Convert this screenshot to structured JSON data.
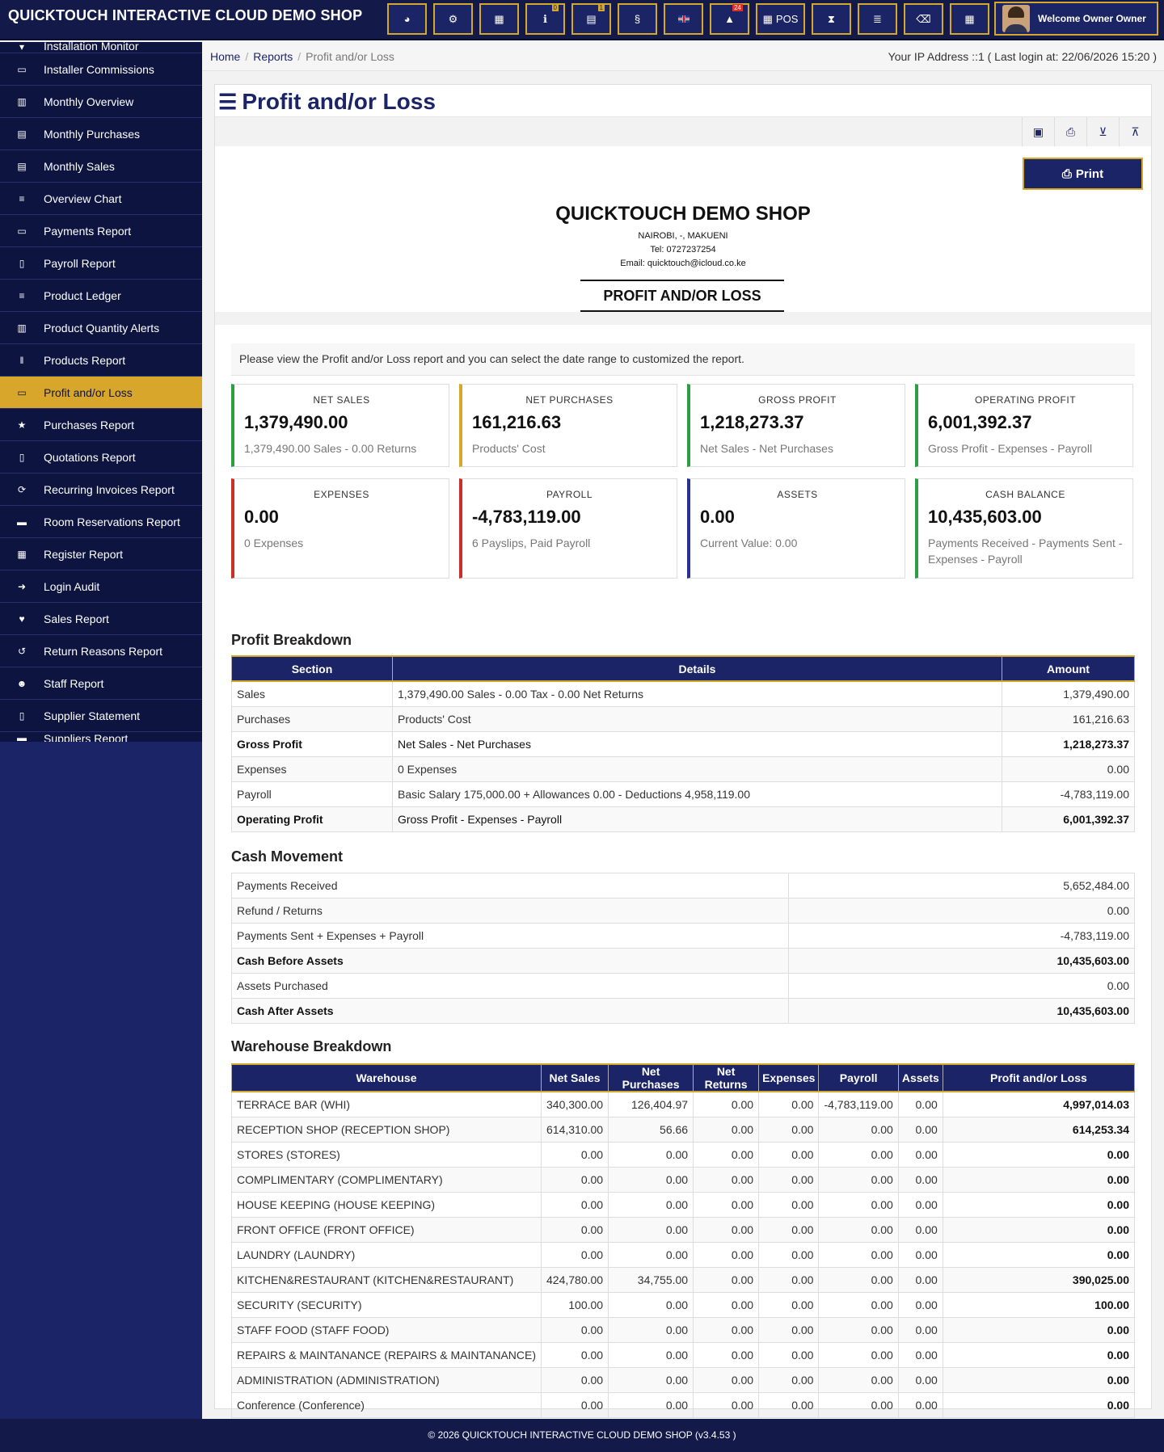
{
  "app": {
    "title": "QUICKTOUCH INTERACTIVE CLOUD DEMO SHOP",
    "welcome": "Welcome Owner Owner",
    "pos_label": "POS"
  },
  "topbar": {
    "badge_info": "0",
    "badge_calendar": "1",
    "badge_alert": "24"
  },
  "sidebar": {
    "partial_top": "Installation Monitor",
    "items": [
      {
        "label": "Installer Commissions",
        "icon": "money-icon"
      },
      {
        "label": "Monthly Overview",
        "icon": "bar-chart-icon"
      },
      {
        "label": "Monthly Purchases",
        "icon": "calendar-icon"
      },
      {
        "label": "Monthly Sales",
        "icon": "calendar-icon"
      },
      {
        "label": "Overview Chart",
        "icon": "list-icon"
      },
      {
        "label": "Payments Report",
        "icon": "money-icon"
      },
      {
        "label": "Payroll Report",
        "icon": "file-icon"
      },
      {
        "label": "Product Ledger",
        "icon": "list-icon"
      },
      {
        "label": "Product Quantity Alerts",
        "icon": "bar-chart-icon"
      },
      {
        "label": "Products Report",
        "icon": "barcode-icon"
      },
      {
        "label": "Profit and/or Loss",
        "icon": "money-icon"
      },
      {
        "label": "Purchases Report",
        "icon": "star-icon"
      },
      {
        "label": "Quotations Report",
        "icon": "file-icon"
      },
      {
        "label": "Recurring Invoices Report",
        "icon": "refresh-icon"
      },
      {
        "label": "Room Reservations Report",
        "icon": "bed-icon"
      },
      {
        "label": "Register Report",
        "icon": "grid-icon"
      },
      {
        "label": "Login Audit",
        "icon": "sign-in-icon"
      },
      {
        "label": "Sales Report",
        "icon": "heart-icon"
      },
      {
        "label": "Return Reasons Report",
        "icon": "undo-icon"
      },
      {
        "label": "Staff Report",
        "icon": "users-icon"
      },
      {
        "label": "Supplier Statement",
        "icon": "file-icon"
      }
    ],
    "partial_bottom": "Suppliers Report"
  },
  "breadcrumb": {
    "home": "Home",
    "reports": "Reports",
    "current": "Profit and/or Loss"
  },
  "ip_info": "Your IP Address ::1 ( Last login at: 22/06/2026 15:20 )",
  "page_title": "Profit and/or Loss",
  "print_label": "Print",
  "shop": {
    "name": "QUICKTOUCH DEMO SHOP",
    "address": "NAIROBI, -, MAKUENI",
    "tel": "Tel: 0727237254",
    "email": "Email: quicktouch@icloud.co.ke",
    "report_title": "PROFIT AND/OR LOSS"
  },
  "intro": "Please view the Profit and/or Loss report and you can select the date range to customized the report.",
  "cards": [
    {
      "title": "NET SALES",
      "value": "1,379,490.00",
      "sub": "1,379,490.00 Sales - 0.00 Returns"
    },
    {
      "title": "NET PURCHASES",
      "value": "161,216.63",
      "sub": "Products' Cost"
    },
    {
      "title": "GROSS PROFIT",
      "value": "1,218,273.37",
      "sub": "Net Sales - Net Purchases"
    },
    {
      "title": "OPERATING PROFIT",
      "value": "6,001,392.37",
      "sub": "Gross Profit - Expenses - Payroll"
    },
    {
      "title": "EXPENSES",
      "value": "0.00",
      "sub": "0 Expenses"
    },
    {
      "title": "PAYROLL",
      "value": "-4,783,119.00",
      "sub": "6 Payslips, Paid Payroll"
    },
    {
      "title": "ASSETS",
      "value": "0.00",
      "sub": "Current Value: 0.00"
    },
    {
      "title": "CASH BALANCE",
      "value": "10,435,603.00",
      "sub": "Payments Received - Payments Sent - Expenses - Payroll"
    }
  ],
  "profit_breakdown": {
    "title": "Profit Breakdown",
    "headers": [
      "Section",
      "Details",
      "Amount"
    ],
    "rows": [
      [
        "Sales",
        "1,379,490.00 Sales - 0.00 Tax - 0.00 Net Returns",
        "1,379,490.00"
      ],
      [
        "Purchases",
        "Products' Cost",
        "161,216.63"
      ],
      [
        "Gross Profit",
        "Net Sales - Net Purchases",
        "1,218,273.37"
      ],
      [
        "Expenses",
        "0 Expenses",
        "0.00"
      ],
      [
        "Payroll",
        "Basic Salary 175,000.00 + Allowances 0.00 - Deductions 4,958,119.00",
        "-4,783,119.00"
      ],
      [
        "Operating Profit",
        "Gross Profit - Expenses - Payroll",
        "6,001,392.37"
      ]
    ]
  },
  "cash_movement": {
    "title": "Cash Movement",
    "rows": [
      [
        "Payments Received",
        "5,652,484.00"
      ],
      [
        "Refund / Returns",
        "0.00"
      ],
      [
        "Payments Sent + Expenses + Payroll",
        "-4,783,119.00"
      ],
      [
        "Cash Before Assets",
        "10,435,603.00"
      ],
      [
        "Assets Purchased",
        "0.00"
      ],
      [
        "Cash After Assets",
        "10,435,603.00"
      ]
    ]
  },
  "warehouse_breakdown": {
    "title": "Warehouse Breakdown",
    "headers": [
      "Warehouse",
      "Net Sales",
      "Net Purchases",
      "Net Returns",
      "Expenses",
      "Payroll",
      "Assets",
      "Profit and/or Loss"
    ],
    "rows": [
      [
        "TERRACE BAR (WHI)",
        "340,300.00",
        "126,404.97",
        "0.00",
        "0.00",
        "-4,783,119.00",
        "0.00",
        "4,997,014.03"
      ],
      [
        "RECEPTION SHOP (RECEPTION SHOP)",
        "614,310.00",
        "56.66",
        "0.00",
        "0.00",
        "0.00",
        "0.00",
        "614,253.34"
      ],
      [
        "STORES (STORES)",
        "0.00",
        "0.00",
        "0.00",
        "0.00",
        "0.00",
        "0.00",
        "0.00"
      ],
      [
        "COMPLIMENTARY (COMPLIMENTARY)",
        "0.00",
        "0.00",
        "0.00",
        "0.00",
        "0.00",
        "0.00",
        "0.00"
      ],
      [
        "HOUSE KEEPING (HOUSE KEEPING)",
        "0.00",
        "0.00",
        "0.00",
        "0.00",
        "0.00",
        "0.00",
        "0.00"
      ],
      [
        "FRONT OFFICE (FRONT OFFICE)",
        "0.00",
        "0.00",
        "0.00",
        "0.00",
        "0.00",
        "0.00",
        "0.00"
      ],
      [
        "LAUNDRY (LAUNDRY)",
        "0.00",
        "0.00",
        "0.00",
        "0.00",
        "0.00",
        "0.00",
        "0.00"
      ],
      [
        "KITCHEN&RESTAURANT (KITCHEN&RESTAURANT)",
        "424,780.00",
        "34,755.00",
        "0.00",
        "0.00",
        "0.00",
        "0.00",
        "390,025.00"
      ],
      [
        "SECURITY (SECURITY)",
        "100.00",
        "0.00",
        "0.00",
        "0.00",
        "0.00",
        "0.00",
        "100.00"
      ],
      [
        "STAFF FOOD (STAFF FOOD)",
        "0.00",
        "0.00",
        "0.00",
        "0.00",
        "0.00",
        "0.00",
        "0.00"
      ],
      [
        "REPAIRS & MAINTANANCE (REPAIRS & MAINTANANCE)",
        "0.00",
        "0.00",
        "0.00",
        "0.00",
        "0.00",
        "0.00",
        "0.00"
      ],
      [
        "ADMINISTRATION (ADMINISTRATION)",
        "0.00",
        "0.00",
        "0.00",
        "0.00",
        "0.00",
        "0.00",
        "0.00"
      ],
      [
        "Conference (Conference)",
        "0.00",
        "0.00",
        "0.00",
        "0.00",
        "0.00",
        "0.00",
        "0.00"
      ]
    ]
  },
  "footer": "© 2026 QUICKTOUCH INTERACTIVE CLOUD DEMO SHOP (v3.4.53 )"
}
